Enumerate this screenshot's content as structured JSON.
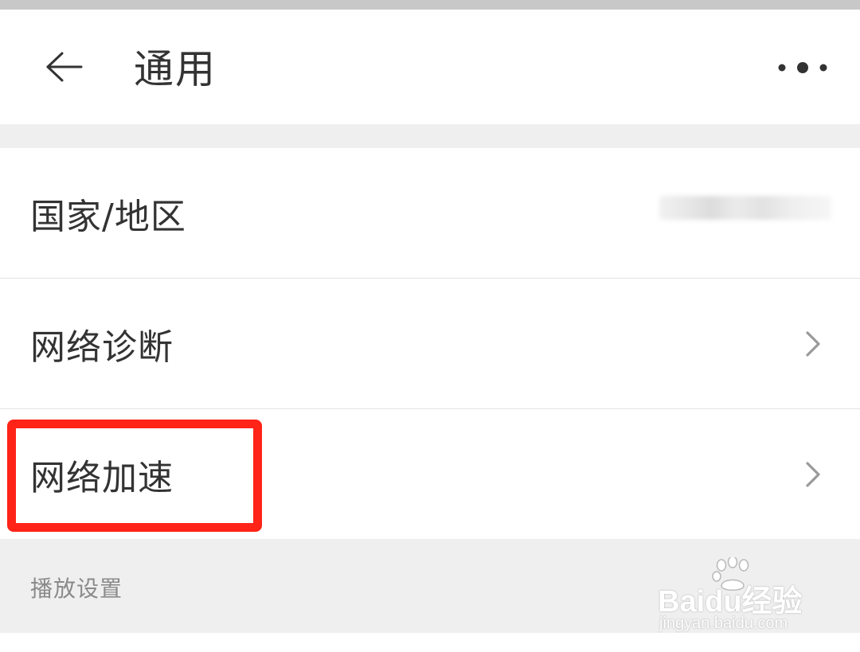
{
  "header": {
    "title": "通用",
    "back_icon": "arrow-left-icon",
    "more_icon": "more-dots-icon"
  },
  "settings": {
    "rows": [
      {
        "label": "国家/地区",
        "value_obscured": true
      },
      {
        "label": "网络诊断",
        "chevron_icon": "chevron-right-icon"
      },
      {
        "label": "网络加速",
        "chevron_icon": "chevron-right-icon",
        "highlighted": true
      }
    ]
  },
  "section": {
    "title": "播放设置"
  },
  "watermark": {
    "brand": "Baidu经验",
    "url": "jingyan.baidu.com"
  },
  "colors": {
    "highlight": "#ff2318",
    "text_primary": "#333333",
    "text_secondary": "#8a8a8a",
    "band": "#efefef"
  }
}
